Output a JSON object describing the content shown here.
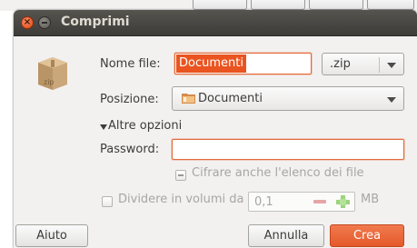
{
  "window": {
    "title": "Comprimi"
  },
  "form": {
    "filename_label": "Nome file:",
    "filename_value": "Documenti",
    "extension_value": ".zip",
    "location_label": "Posizione:",
    "location_value": "Documenti",
    "options_expander": "Altre opzioni",
    "password_label": "Password:",
    "password_value": "",
    "encrypt_list_label": "Cifrare anche l'elenco dei file",
    "split_label": "Dividere in volumi da",
    "split_value": "0,1",
    "split_unit": "MB"
  },
  "buttons": {
    "help": "Aiuto",
    "cancel": "Annulla",
    "create": "Crea"
  },
  "colors": {
    "accent": "#e95420",
    "titlebar": "#3d3c38"
  }
}
